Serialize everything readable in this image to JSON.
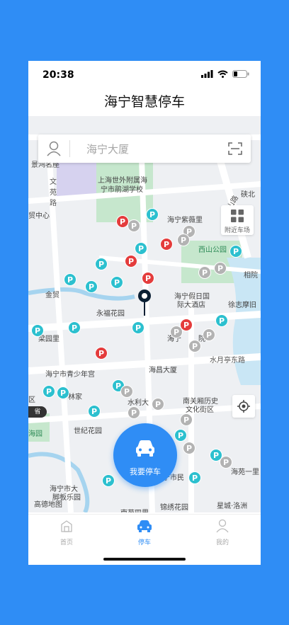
{
  "status": {
    "time": "20:38"
  },
  "navbar": {
    "title": "海宁智慧停车"
  },
  "search": {
    "text": "海宁大厦"
  },
  "nearby": {
    "label": "附近车场"
  },
  "main_button": {
    "label": "我要停车"
  },
  "edge_tag": "省",
  "map_labels": [
    {
      "text": "景鸿名座",
      "cls": ""
    },
    {
      "text": "文苑路",
      "cls": "road"
    },
    {
      "text": "上海世外附属海",
      "cls": ""
    },
    {
      "text": "宁市鹃湖学校",
      "cls": ""
    },
    {
      "text": "西山路",
      "cls": "road"
    },
    {
      "text": "硖北",
      "cls": ""
    },
    {
      "text": "贸中心",
      "cls": ""
    },
    {
      "text": "海宁紫薇里",
      "cls": ""
    },
    {
      "text": "西山公园",
      "cls": "green"
    },
    {
      "text": "相院",
      "cls": ""
    },
    {
      "text": "金贸",
      "cls": ""
    },
    {
      "text": "永福花园",
      "cls": ""
    },
    {
      "text": "海宁假日国",
      "cls": ""
    },
    {
      "text": "际大酒店",
      "cls": ""
    },
    {
      "text": "徐志摩旧",
      "cls": ""
    },
    {
      "text": "梁园里",
      "cls": ""
    },
    {
      "text": "海宁",
      "cls": ""
    },
    {
      "text": "院",
      "cls": ""
    },
    {
      "text": "水月亭东路",
      "cls": "road"
    },
    {
      "text": "海宁市青少年宫",
      "cls": ""
    },
    {
      "text": "海昌大厦",
      "cls": ""
    },
    {
      "text": "林家",
      "cls": ""
    },
    {
      "text": "水利大",
      "cls": ""
    },
    {
      "text": "南关厢历史",
      "cls": ""
    },
    {
      "text": "文化街区",
      "cls": ""
    },
    {
      "text": "海园",
      "cls": "green"
    },
    {
      "text": "世纪花园",
      "cls": ""
    },
    {
      "text": "海宁市大",
      "cls": ""
    },
    {
      "text": "脚板乐园",
      "cls": ""
    },
    {
      "text": "宁市民",
      "cls": ""
    },
    {
      "text": "海苑一里",
      "cls": ""
    },
    {
      "text": "南苑四里",
      "cls": ""
    },
    {
      "text": "锦绣花园",
      "cls": ""
    },
    {
      "text": "星城·洛洲",
      "cls": ""
    },
    {
      "text": "区",
      "cls": ""
    }
  ],
  "map_logo": "高德地图",
  "tabs": [
    {
      "label": "首页",
      "icon": "home-icon"
    },
    {
      "label": "停车",
      "icon": "car-icon"
    },
    {
      "label": "我的",
      "icon": "profile-icon"
    }
  ]
}
